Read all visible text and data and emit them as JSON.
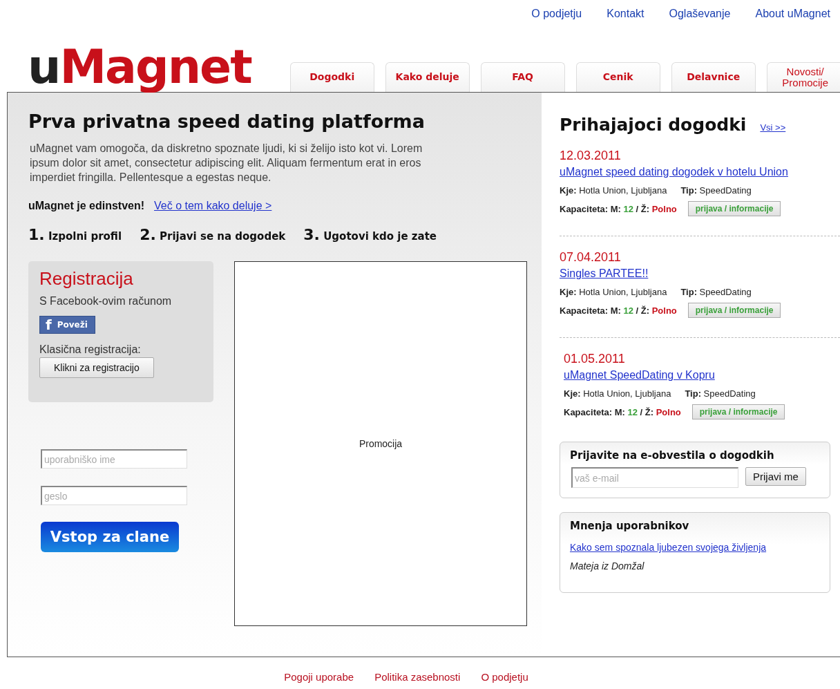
{
  "top_links": [
    "O podjetju",
    "Kontakt",
    "Oglaševanje",
    "About uMagnet"
  ],
  "logo": "uMagnet",
  "tabs": [
    {
      "label": "Dogodki",
      "selected": false
    },
    {
      "label": "Kako deluje",
      "selected": false
    },
    {
      "label": "FAQ",
      "selected": false
    },
    {
      "label": "Cenik",
      "selected": false
    },
    {
      "label": "Delavnice",
      "selected": false
    },
    {
      "label": "Novosti/ Promocije",
      "selected": false
    }
  ],
  "intro": {
    "title": "Prva privatna speed dating platforma",
    "text": "uMagnet vam omogoča, da diskretno spoznate ljudi, ki si želijo isto kot vi. Lorem ipsum dolor sit amet, consectetur adipiscing elit. Aliquam fermentum erat in eros imperdiet fringilla. Pellentesque a egestas neque.",
    "unique": "uMagnet je edinstven!",
    "more_link": "Več o tem kako deluje >"
  },
  "steps": [
    {
      "number": "1.",
      "label": "Izpolni profil"
    },
    {
      "number": "2.",
      "label": "Prijavi se na dogodek"
    },
    {
      "number": "3.",
      "label": "Ugotovi kdo je zate"
    }
  ],
  "registration": {
    "title": "Registracija",
    "facebook_label": "S Facebook-ovim računom",
    "facebook_icon": "f",
    "facebook_button": "Poveži",
    "classic_label": "Klasična registracija:",
    "classic_button": "Klikni za registracijo"
  },
  "login": {
    "username": {
      "placeholder": "uporabniško ime"
    },
    "password": {
      "placeholder": "geslo"
    },
    "button": "Vstop za clane"
  },
  "promo": "Promocija",
  "events": {
    "title": "Prihajajoci dogodki",
    "all_link": "Vsi >>",
    "items": [
      {
        "date": "12.03.2011",
        "name": "uMagnet speed dating dogodek v hotelu Union",
        "where_label": "Kje:",
        "where": "Hotla Union, Ljubljana",
        "type_label": "Tip:",
        "type": "SpeedDating",
        "capacity_label": "Kapaciteta: M:",
        "male": "12",
        "separator": "/",
        "female_label": "Ž:",
        "female": "Polno",
        "button": "prijava / informacije"
      },
      {
        "date": "07.04.2011",
        "name": "Singles PARTEE!!",
        "where_label": "Kje:",
        "where": "Hotla Union, Ljubljana",
        "type_label": "Tip:",
        "type": "SpeedDating",
        "capacity_label": "Kapaciteta: M:",
        "male": "12",
        "separator": "/",
        "female_label": "Ž:",
        "female": "Polno",
        "button": "prijava / informacije"
      },
      {
        "date": "01.05.2011",
        "name": "uMagnet SpeedDating v Kopru",
        "where_label": "Kje:",
        "where": "Hotla Union, Ljubljana",
        "type_label": "Tip:",
        "type": "SpeedDating",
        "capacity_label": "Kapaciteta: M:",
        "male": "12",
        "separator": "/",
        "female_label": "Ž:",
        "female": "Polno",
        "button": "prijava / informacije"
      }
    ]
  },
  "newsletter": {
    "title": "Prijavite na e-obvestila o dogodkih",
    "email": {
      "placeholder": "vaš e-mail"
    },
    "button": "Prijavi me"
  },
  "reviews": {
    "title": "Mnenja uporabnikov",
    "link": "Kako sem spoznala ljubezen svojega življenja",
    "author": "Mateja iz Domžal"
  },
  "footer_links": [
    "Pogoji uporabe",
    "Politika zasebnosti",
    "O podjetju"
  ]
}
